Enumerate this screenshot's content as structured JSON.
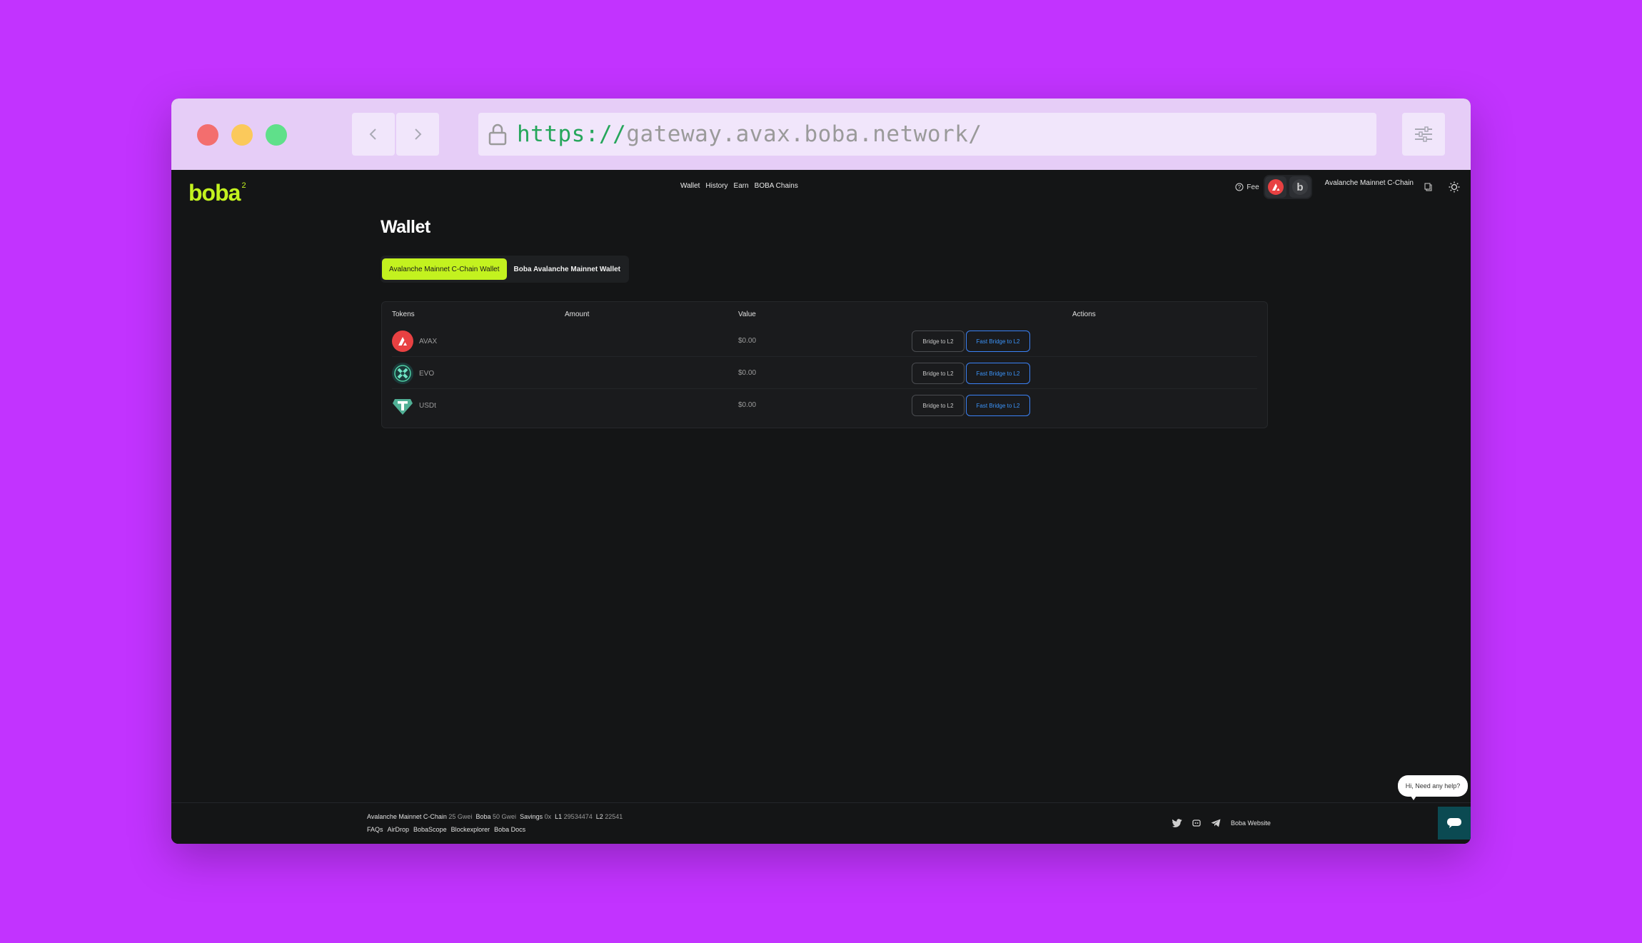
{
  "browser": {
    "url_scheme": "https://",
    "url_host": "gateway.avax.boba.network/"
  },
  "app": {
    "logo_text": "boba",
    "logo_sup": "2",
    "nav": [
      "Wallet",
      "History",
      "Earn",
      "BOBA Chains"
    ],
    "fee_label": "Fee",
    "chain_name": "Avalanche Mainnet C-Chain"
  },
  "page": {
    "title": "Wallet",
    "tabs": [
      "Avalanche Mainnet C-Chain Wallet",
      "Boba Avalanche Mainnet Wallet"
    ],
    "active_tab": 0
  },
  "table": {
    "headers": [
      "Tokens",
      "Amount",
      "Value",
      "Actions"
    ],
    "rows": [
      {
        "symbol": "AVAX",
        "value": "$0.00",
        "bridge": "Bridge to L2",
        "fast": "Fast Bridge to L2"
      },
      {
        "symbol": "EVO",
        "value": "$0.00",
        "bridge": "Bridge to L2",
        "fast": "Fast Bridge to L2"
      },
      {
        "symbol": "USDt",
        "value": "$0.00",
        "bridge": "Bridge to L2",
        "fast": "Fast Bridge to L2"
      }
    ]
  },
  "footer": {
    "l1_chain": "Avalanche Mainnet C-Chain",
    "l1_gas": "25 Gwei",
    "boba_label": "Boba",
    "boba_gas": "50 Gwei",
    "savings_label": "Savings",
    "savings_value": "0x",
    "l1_label": "L1",
    "l1_block": "29534474",
    "l2_label": "L2",
    "l2_block": "22541",
    "links": [
      "FAQs",
      "AirDrop",
      "BobaScope",
      "Blockexplorer",
      "Boba Docs"
    ],
    "website": "Boba Website"
  },
  "help": {
    "bubble": "Hi, Need any help?"
  },
  "colors": {
    "background": "#c233ff",
    "accent": "#c3f21f",
    "fast_bridge": "#3b82f6"
  }
}
